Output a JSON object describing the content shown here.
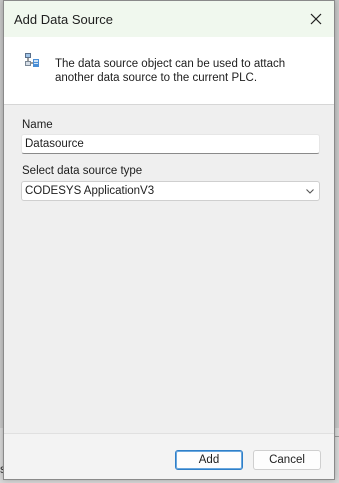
{
  "dialog": {
    "title": "Add Data Source",
    "close_icon": "close-icon"
  },
  "header": {
    "icon": "data-source-icon",
    "description": "The data source object can be used to attach another data source to the current PLC."
  },
  "form": {
    "name_label": "Name",
    "name_value": "Datasource",
    "type_label": "Select data source type",
    "type_value": "CODESYS ApplicationV3"
  },
  "footer": {
    "add_label": "Add",
    "cancel_label": "Cancel"
  },
  "background": {
    "partial_text": "s"
  },
  "colors": {
    "title_bar": "#f0f8ee",
    "primary_border": "#2f7fc8"
  }
}
